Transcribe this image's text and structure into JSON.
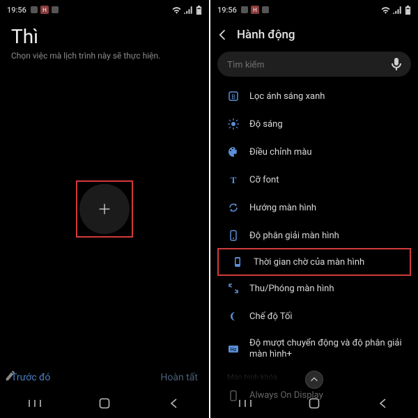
{
  "status": {
    "time": "19:56"
  },
  "left": {
    "title": "Thì",
    "subtitle": "Chọn việc mà lịch trình này sẽ thực hiện.",
    "prev": "Trước đó",
    "done": "Hoàn tất"
  },
  "right": {
    "headerTitle": "Hành động",
    "searchPlaceholder": "Tìm kiếm",
    "rows": {
      "blueLightFilter": "Lọc ánh sáng xanh",
      "brightness": "Độ sáng",
      "colorAdjust": "Điều chỉnh màu",
      "fontSize": "Cỡ font",
      "orientation": "Hướng màn hình",
      "resolution": "Độ phân giải màn hình",
      "screenTimeout": "Thời gian chờ của màn hình",
      "zoom": "Thu/Phóng màn hình",
      "darkMode": "Chế độ Tối",
      "motion": "Độ mượt chuyển động và độ phân giải màn hình+"
    },
    "section": "Màn hình khóa",
    "aod": "Always On Display"
  }
}
